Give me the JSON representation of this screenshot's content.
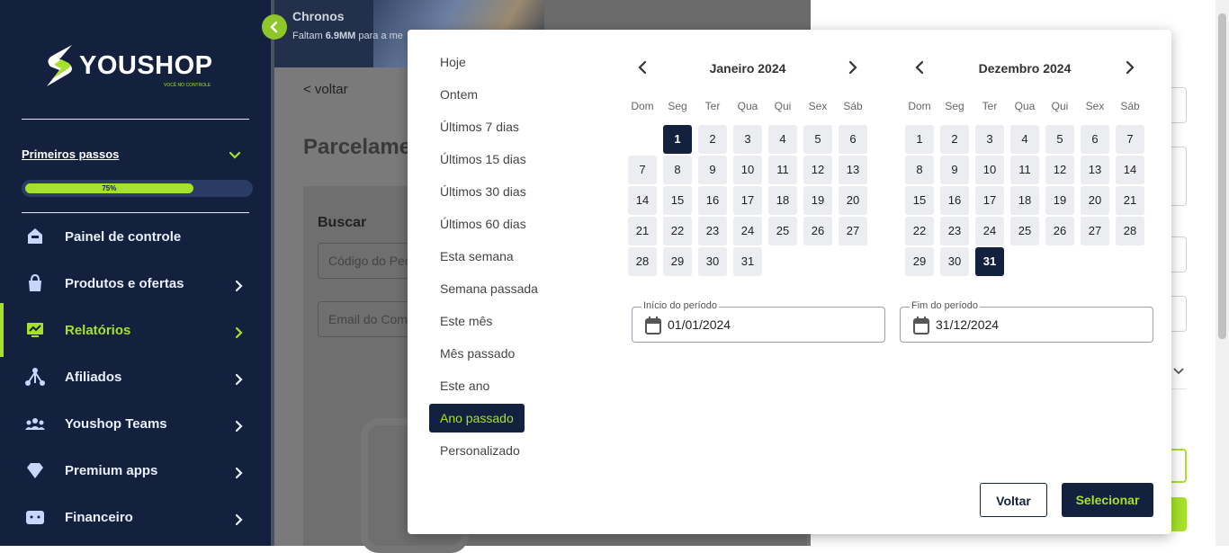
{
  "colors": {
    "navy": "#13213e",
    "lime": "#a6e12c"
  },
  "sidebar": {
    "logo_text": "YOUSHOP",
    "logo_tagline": "VOCÊ NO CONTROLE",
    "primeiros_passos": "Primeiros passos",
    "progress": {
      "percent": 75,
      "label": "75%"
    },
    "items": [
      {
        "label": "Painel de controle",
        "icon": "home-icon",
        "has_chevron": false
      },
      {
        "label": "Produtos e ofertas",
        "icon": "bag-icon",
        "has_chevron": true
      },
      {
        "label": "Relatórios",
        "icon": "report-icon",
        "has_chevron": true,
        "active": true
      },
      {
        "label": "Afiliados",
        "icon": "affiliates-icon",
        "has_chevron": true
      },
      {
        "label": "Youshop Teams",
        "icon": "team-icon",
        "has_chevron": true
      },
      {
        "label": "Premium apps",
        "icon": "diamond-icon",
        "has_chevron": true
      },
      {
        "label": "Financeiro",
        "icon": "wallet-icon",
        "has_chevron": true
      }
    ]
  },
  "banner": {
    "title": "Chronos",
    "sub_prefix": "Faltam ",
    "sub_strong": "6.9MM",
    "sub_suffix": " para a me"
  },
  "main": {
    "back_link": "< voltar",
    "page_title": "Parcelame",
    "card_title": "Buscar",
    "field_1": "Código do Ped",
    "field_2": "Email do Com"
  },
  "modal": {
    "presets": [
      "Hoje",
      "Ontem",
      "Últimos 7 dias",
      "Últimos 15 dias",
      "Últimos 30 dias",
      "Últimos 60 dias",
      "Esta semana",
      "Semana passada",
      "Este mês",
      "Mês passado",
      "Este ano",
      "Ano passado",
      "Personalizado"
    ],
    "selected_preset": "Ano passado",
    "weekdays": [
      "Dom",
      "Seg",
      "Ter",
      "Qua",
      "Qui",
      "Sex",
      "Sáb"
    ],
    "calendars": [
      {
        "title": "Janeiro 2024",
        "first_weekday": 1,
        "days": 31,
        "selected_day": 1
      },
      {
        "title": "Dezembro 2024",
        "first_weekday": 0,
        "days": 31,
        "selected_day": 31
      }
    ],
    "start_field": {
      "label": "Início do período",
      "value": "01/01/2024"
    },
    "end_field": {
      "label": "Fim do período",
      "value": "31/12/2024"
    },
    "back_button": "Voltar",
    "select_button": "Selecionar"
  }
}
